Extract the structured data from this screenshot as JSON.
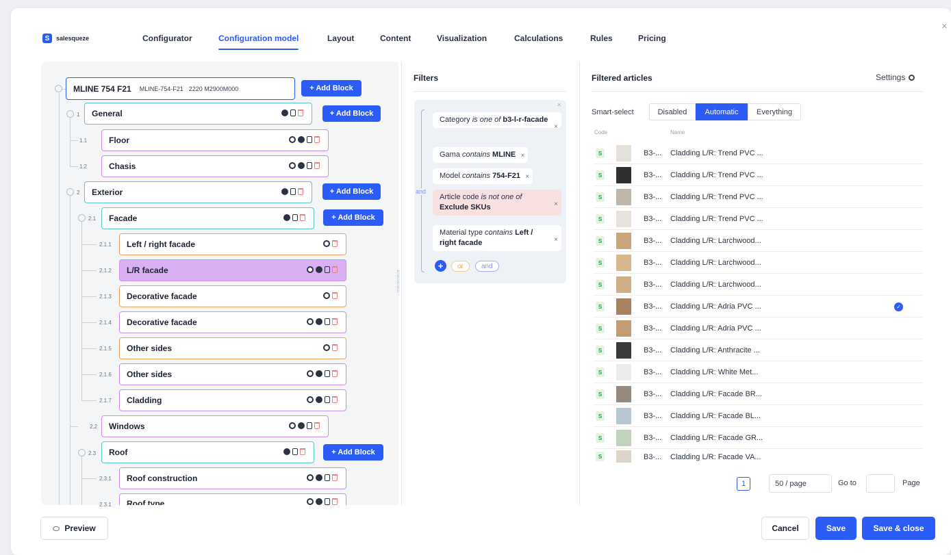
{
  "brand": {
    "name": "salesqueze",
    "logo_letter": "S"
  },
  "nav": [
    {
      "label": "Configurator"
    },
    {
      "label": "Configuration model",
      "active": true
    },
    {
      "label": "Layout"
    },
    {
      "label": "Content"
    },
    {
      "label": "Visualization"
    },
    {
      "label": "Calculations"
    },
    {
      "label": "Rules"
    },
    {
      "label": "Pricing"
    }
  ],
  "close_label": "×",
  "tree": {
    "root": {
      "label": "MLINE 754 F21",
      "code": "MLINE-754-F21",
      "sub": "2220 M2900M000"
    },
    "add_block_label": "+ Add Block",
    "nodes": [
      {
        "num": "1",
        "label": "General"
      },
      {
        "num": "1.1",
        "label": "Floor"
      },
      {
        "num": "1.2",
        "label": "Chasis"
      },
      {
        "num": "2",
        "label": "Exterior"
      },
      {
        "num": "2.1",
        "label": "Facade"
      },
      {
        "num": "2.1.1",
        "label": "Left / right facade"
      },
      {
        "num": "2.1.2",
        "label": "L/R facade"
      },
      {
        "num": "2.1.3",
        "label": "Decorative facade"
      },
      {
        "num": "2.1.4",
        "label": "Decorative facade"
      },
      {
        "num": "2.1.5",
        "label": "Other sides"
      },
      {
        "num": "2.1.6",
        "label": "Other sides"
      },
      {
        "num": "2.1.7",
        "label": "Cladding"
      },
      {
        "num": "2.2",
        "label": "Windows"
      },
      {
        "num": "2.3",
        "label": "Roof"
      },
      {
        "num": "2.3.1",
        "label": "Roof construction"
      },
      {
        "num": "2.3.1",
        "label": "Roof type"
      }
    ]
  },
  "filters": {
    "title": "Filters",
    "and_label": "and",
    "chips": [
      {
        "pre": "Category ",
        "op": "is one of ",
        "val": "b3-l-r-facade"
      },
      {
        "pre": "Gama ",
        "op": "contains ",
        "val": "MLINE"
      },
      {
        "pre": "Model ",
        "op": "contains ",
        "val": "754-F21"
      },
      {
        "pre": "Article code ",
        "op": "is not one of ",
        "val": "Exclude SKUs"
      },
      {
        "pre": "Material type ",
        "op": "contains ",
        "val": "Left / right facade"
      }
    ],
    "chip_close": "×",
    "add_symbol": "+",
    "or_label": "or",
    "and_pill_label": "and"
  },
  "articles": {
    "title": "Filtered articles",
    "settings_label": "Settings",
    "smart_select_label": "Smart-select",
    "modes": [
      "Disabled",
      "Automatic",
      "Everything"
    ],
    "active_mode": "Automatic",
    "columns": {
      "code": "Code",
      "name": "Name"
    },
    "rows": [
      {
        "status": "S",
        "code": "B3-...",
        "name": "Cladding L/R: Trend PVC ...",
        "swatch": "#e4e0da"
      },
      {
        "status": "S",
        "code": "B3-...",
        "name": "Cladding L/R: Trend PVC ...",
        "swatch": "#2f2f30"
      },
      {
        "status": "S",
        "code": "B3-...",
        "name": "Cladding L/R: Trend PVC ...",
        "swatch": "#bfb7a9"
      },
      {
        "status": "S",
        "code": "B3-...",
        "name": "Cladding L/R: Trend PVC ...",
        "swatch": "#e7e3dc"
      },
      {
        "status": "S",
        "code": "B3-...",
        "name": "Cladding L/R: Larchwood...",
        "swatch": "#c9a57a"
      },
      {
        "status": "S",
        "code": "B3-...",
        "name": "Cladding L/R: Larchwood...",
        "swatch": "#d7b88d"
      },
      {
        "status": "S",
        "code": "B3-...",
        "name": "Cladding L/R: Larchwood...",
        "swatch": "#cfae88"
      },
      {
        "status": "S",
        "code": "B3-...",
        "name": "Cladding L/R: Adria PVC ...",
        "swatch": "#a7835f",
        "checked": true
      },
      {
        "status": "S",
        "code": "B3-...",
        "name": "Cladding L/R: Adria PVC ...",
        "swatch": "#c19c74"
      },
      {
        "status": "S",
        "code": "B3-...",
        "name": "Cladding L/R: Anthracite ...",
        "swatch": "#3a3a3c"
      },
      {
        "status": "S",
        "code": "B3-...",
        "name": "Cladding L/R: White Met...",
        "swatch": "#ececea"
      },
      {
        "status": "S",
        "code": "B3-...",
        "name": "Cladding L/R: Facade BR...",
        "swatch": "#958a80"
      },
      {
        "status": "S",
        "code": "B3-...",
        "name": "Cladding L/R: Facade BL...",
        "swatch": "#b8c8d3"
      },
      {
        "status": "S",
        "code": "B3-...",
        "name": "Cladding L/R: Facade GR...",
        "swatch": "#c2d2bc"
      },
      {
        "status": "S",
        "code": "B3-...",
        "name": "Cladding L/R: Facade VA...",
        "swatch": "#ddd6c8"
      }
    ],
    "pagination": {
      "page": "1",
      "per_page": "50 / page",
      "goto_label": "Go to",
      "page_label": "Page"
    }
  },
  "footer": {
    "preview_label": "Preview",
    "cancel_label": "Cancel",
    "save_label": "Save",
    "save_close_label": "Save & close"
  },
  "colors": {
    "accent": "#2c5cf6",
    "teal": "#5ac8c5",
    "purple": "#c98ef0",
    "orange": "#f0a05a",
    "selected": "#d9b1f2"
  }
}
